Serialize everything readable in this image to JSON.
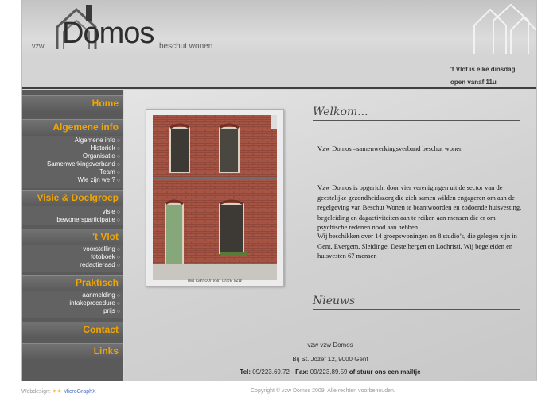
{
  "header": {
    "org_prefix": "vzw",
    "brand": "Domos",
    "tagline": "beschut wonen"
  },
  "announcement": {
    "line1": "'t Vlot is elke dinsdag",
    "line2": "open vanaf 11u"
  },
  "sidebar": {
    "home": "Home",
    "algemene": {
      "title": "Algemene info",
      "items": [
        "Algemene info",
        "Historiek",
        "Organisatie",
        "Samenwerkingsverband",
        "Team",
        "Wie zijn we ?"
      ]
    },
    "visie": {
      "title": "Visie & Doelgroep",
      "items": [
        "visie",
        "bewonersparticipatie"
      ]
    },
    "vlot": {
      "title": "'t Vlot",
      "items": [
        "voorstelling",
        "fotoboek",
        "redactieraad"
      ]
    },
    "praktisch": {
      "title": "Praktisch",
      "items": [
        "aanmelding",
        "intakeprocedure",
        "prijs"
      ]
    },
    "contact": "Contact",
    "links": "Links"
  },
  "main": {
    "photo_caption": "het kantoor van onze vzw",
    "welcome_title": "Welkom...",
    "intro": "Vzw Domos –samenwerkingsverband beschut wonen",
    "paragraph1": "Vzw Domos is opgericht door vier verenigingen uit de sector van de geestelijke gezondheidszorg die zich samen wilden engageren om aan de regelgeving van Beschut Wonen te beantwoorden en zodoende huisvesting, begeleiding en dagactiviteiten aan te reiken aan mensen die er om psychische redenen nood aan hebben.",
    "paragraph2": "Wij beschikken over 14 groepswoningen en 8 studio’s, die gelegen zijn in Gent, Evergem,  Sleidinge, Destelbergen en Lochristi. Wij begeleiden en huisvesten 67 mensen",
    "news_title": "Nieuws"
  },
  "footer": {
    "org": "vzw vzw Domos",
    "address": "Bij St. Jozef 12, 9000 Gent",
    "tel_label": "Tel:",
    "tel": "09/223.69.72",
    "fax_label": "Fax:",
    "fax": "09/223.89.59",
    "of": "of",
    "mail_link": "stuur ons een mailtje"
  },
  "page_footer": {
    "webdesign_label": "Webdesign:",
    "designer": "MicroGraphX",
    "copyright": "Copyright © vzw Domos 2009. Alle rechten voorbehouden."
  },
  "colors": {
    "accent": "#f0a500",
    "sidebar_bg": "#5a5a5a",
    "frame_bg": "#d6d6d6"
  }
}
